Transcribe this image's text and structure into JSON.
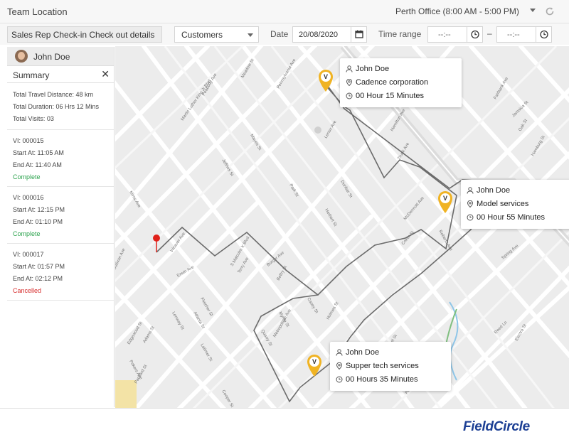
{
  "header": {
    "title": "Team Location",
    "office": "Perth Office (8:00 AM - 5:00 PM)"
  },
  "toolbar": {
    "sales_button": "Sales Rep Check-in Check out details",
    "customers_select": "Customers",
    "date_label": "Date",
    "date_value": "20/08/2020",
    "time_label": "Time range",
    "time_start": "--:--",
    "time_end": "--:--",
    "time_sep": "–"
  },
  "sidebar": {
    "user_name": "John Doe",
    "summary_title": "Summary",
    "close": "✕",
    "stats": {
      "distance": "Total Travel Distance: 48 km",
      "duration": "Total Duration: 06 Hrs 12 Mins",
      "visits": "Total Visits: 03"
    },
    "visits": [
      {
        "id": "VI: 000015",
        "start": "Start At: 11:05 AM",
        "end": "End At: 11:40 AM",
        "status": "Complete"
      },
      {
        "id": "VI: 000016",
        "start": "Start At: 12:15 PM",
        "end": "End At: 01:10 PM",
        "status": "Complete"
      },
      {
        "id": "VI: 000017",
        "start": "Start At: 01:57 PM",
        "end": "End At: 02:12 PM",
        "status": "Cancelled"
      }
    ]
  },
  "map": {
    "pin_label": "V",
    "cards": [
      {
        "name": "John Doe",
        "company": "Cadence corporation",
        "duration": "00 Hour 15 Minutes"
      },
      {
        "name": "John Doe",
        "company": "Model services",
        "duration": "00 Hour 55 Minutes"
      },
      {
        "name": "John Doe",
        "company": "Supper tech services",
        "duration": "00 Hours 35 Minutes"
      }
    ],
    "streets": [
      "Pennsylvania Ave",
      "Martin Luther King Jr Blvd",
      "S Malcolm X Blvd",
      "Metropolitan Ave",
      "Meadow St",
      "Peabody Ave",
      "Jeffries St",
      "Lenox Ave",
      "Myrtle St",
      "Pine St",
      "Hamilton Ave",
      "Oak St",
      "Trunk Ave",
      "McDermott Ave",
      "Roberts Ave",
      "Spring Ave",
      "Reed Ln",
      "Electra St",
      "Mims Ave",
      "Pokers Ave",
      "Packard St",
      "Cooper St",
      "Adams St",
      "Sullivan Ave",
      "Erwin Ave",
      "Fletcher St",
      "Atlanta St",
      "Lenway St",
      "Park St",
      "Dunbar St",
      "Herbert St",
      "Mayes St",
      "Quarry St",
      "Chapel St",
      "Terry Ave",
      "Weaver Ave",
      "Burger Ave",
      "Bethy St",
      "Jamaica St",
      "Hamburg St",
      "Edgewood St",
      "Latimer St",
      "Casey St",
      "Holmes St",
      "Fairbank Ave",
      "Coker St"
    ],
    "route_color": "#6b6b6b",
    "pin_color": "#f0b323",
    "origin_color": "#e0211a"
  },
  "footer": {
    "logo": "FieldCircle"
  }
}
